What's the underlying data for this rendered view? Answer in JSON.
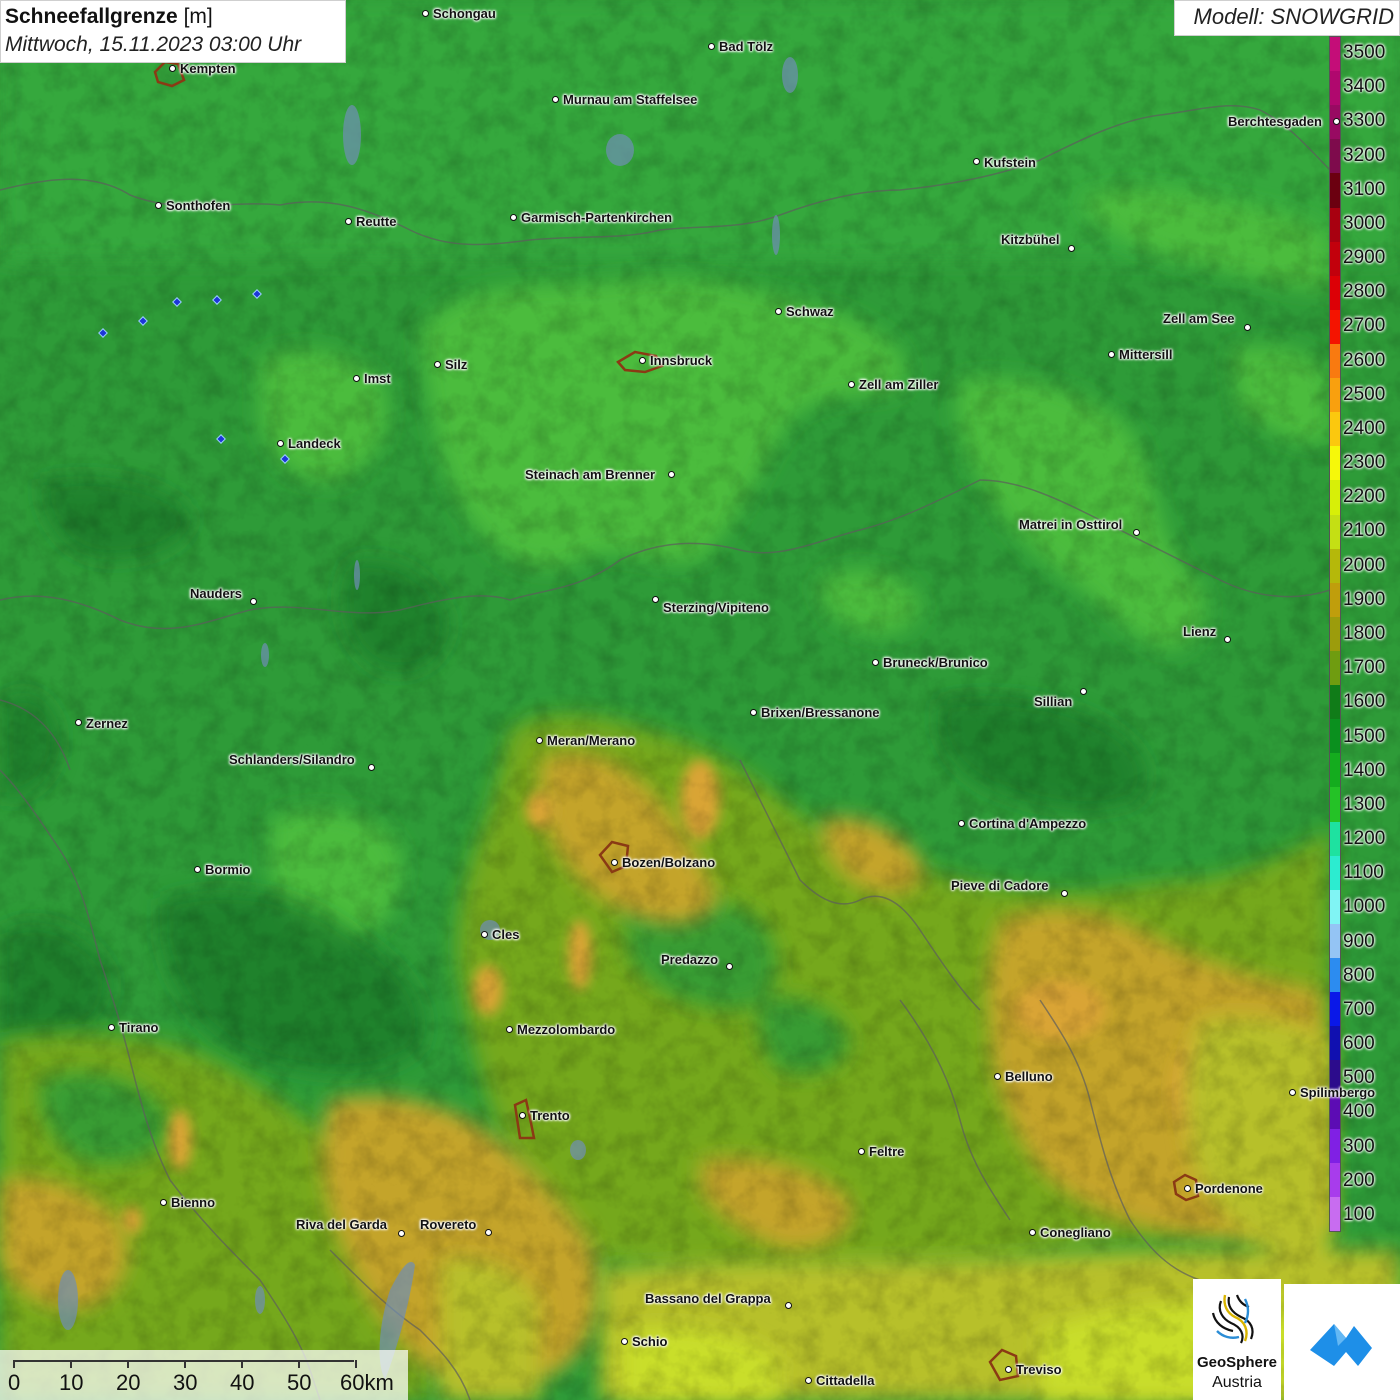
{
  "title": {
    "name": "Schneefallgrenze",
    "unit": "[m]",
    "datetime": "Mittwoch, 15.11.2023 03:00 Uhr"
  },
  "model": "Modell: SNOWGRID",
  "legend": {
    "labels": [
      "3500",
      "3400",
      "3300",
      "3200",
      "3100",
      "3000",
      "2900",
      "2800",
      "2700",
      "2600",
      "2500",
      "2400",
      "2300",
      "2200",
      "2100",
      "2000",
      "1900",
      "1800",
      "1700",
      "1600",
      "1500",
      "1400",
      "1300",
      "1200",
      "1100",
      "1000",
      "900",
      "800",
      "700",
      "600",
      "500",
      "400",
      "300",
      "200",
      "100"
    ],
    "colors": [
      "#c40d78",
      "#b0086e",
      "#980a62",
      "#7e0b4c",
      "#6b0010",
      "#a80010",
      "#c2000c",
      "#dc0006",
      "#f41400",
      "#f97a10",
      "#f9a00e",
      "#fbc80e",
      "#f6f80a",
      "#d7ef08",
      "#c4df14",
      "#b5b80a",
      "#c09e0c",
      "#9c9c0c",
      "#6f9c10",
      "#107c18",
      "#0a901e",
      "#14ac1e",
      "#24c226",
      "#1ee2a0",
      "#2cecd0",
      "#80f4f4",
      "#94c4f4",
      "#2c8cf0",
      "#0a18e8",
      "#1010b0",
      "#2c0c8c",
      "#5c0cb4",
      "#8020e4",
      "#a83cec",
      "#c86cf0"
    ]
  },
  "cities": [
    {
      "name": "Schongau",
      "dot": [
        425,
        13
      ],
      "label": [
        433,
        7
      ]
    },
    {
      "name": "Bad Tölz",
      "dot": [
        711,
        46
      ],
      "label": [
        719,
        40
      ]
    },
    {
      "name": "Kempten",
      "dot": [
        172,
        68
      ],
      "label": [
        180,
        62
      ]
    },
    {
      "name": "Murnau am Staffelsee",
      "dot": [
        555,
        99
      ],
      "label": [
        563,
        93
      ]
    },
    {
      "name": "Berchtesgaden",
      "dot": [
        1336,
        121
      ],
      "label": [
        1228,
        115
      ]
    },
    {
      "name": "Kufstein",
      "dot": [
        976,
        161
      ],
      "label": [
        984,
        156
      ]
    },
    {
      "name": "Sonthofen",
      "dot": [
        158,
        205
      ],
      "label": [
        166,
        199
      ]
    },
    {
      "name": "Reutte",
      "dot": [
        348,
        221
      ],
      "label": [
        356,
        215
      ]
    },
    {
      "name": "Garmisch-Partenkirchen",
      "dot": [
        513,
        217
      ],
      "label": [
        521,
        211
      ]
    },
    {
      "name": "Kitzbühel",
      "dot": [
        1071,
        248
      ],
      "label": [
        1001,
        233
      ]
    },
    {
      "name": "Schwaz",
      "dot": [
        778,
        311
      ],
      "label": [
        786,
        305
      ]
    },
    {
      "name": "Zell am See",
      "dot": [
        1247,
        327
      ],
      "label": [
        1163,
        312
      ]
    },
    {
      "name": "Mittersill",
      "dot": [
        1111,
        354
      ],
      "label": [
        1119,
        348
      ]
    },
    {
      "name": "Innsbruck",
      "dot": [
        642,
        360
      ],
      "label": [
        650,
        354
      ]
    },
    {
      "name": "Silz",
      "dot": [
        437,
        364
      ],
      "label": [
        445,
        358
      ]
    },
    {
      "name": "Imst",
      "dot": [
        356,
        378
      ],
      "label": [
        364,
        372
      ]
    },
    {
      "name": "Zell am Ziller",
      "dot": [
        851,
        384
      ],
      "label": [
        859,
        378
      ]
    },
    {
      "name": "Landeck",
      "dot": [
        280,
        443
      ],
      "label": [
        288,
        437
      ]
    },
    {
      "name": "Steinach am Brenner",
      "dot": [
        671,
        474
      ],
      "label": [
        525,
        468
      ]
    },
    {
      "name": "Matrei in Osttirol",
      "dot": [
        1136,
        532
      ],
      "label": [
        1019,
        518
      ]
    },
    {
      "name": "Nauders",
      "dot": [
        253,
        601
      ],
      "label": [
        190,
        587
      ]
    },
    {
      "name": "Sterzing/Vipiteno",
      "dot": [
        655,
        599
      ],
      "label": [
        663,
        601
      ]
    },
    {
      "name": "Lienz",
      "dot": [
        1227,
        639
      ],
      "label": [
        1183,
        625
      ]
    },
    {
      "name": "Bruneck/Brunico",
      "dot": [
        875,
        662
      ],
      "label": [
        883,
        656
      ]
    },
    {
      "name": "Sillian",
      "dot": [
        1083,
        691
      ],
      "label": [
        1034,
        695
      ]
    },
    {
      "name": "Brixen/Bressanone",
      "dot": [
        753,
        712
      ],
      "label": [
        761,
        706
      ]
    },
    {
      "name": "Zernez",
      "dot": [
        78,
        722
      ],
      "label": [
        86,
        717
      ]
    },
    {
      "name": "Meran/Merano",
      "dot": [
        539,
        740
      ],
      "label": [
        547,
        734
      ]
    },
    {
      "name": "Schlanders/Silandro",
      "dot": [
        371,
        767
      ],
      "label": [
        229,
        753
      ]
    },
    {
      "name": "Cortina d'Ampezzo",
      "dot": [
        961,
        823
      ],
      "label": [
        969,
        817
      ]
    },
    {
      "name": "Bozen/Bolzano",
      "dot": [
        614,
        862
      ],
      "label": [
        622,
        856
      ]
    },
    {
      "name": "Bormio",
      "dot": [
        197,
        869
      ],
      "label": [
        205,
        863
      ]
    },
    {
      "name": "Pieve di Cadore",
      "dot": [
        1064,
        893
      ],
      "label": [
        951,
        879
      ]
    },
    {
      "name": "Cles",
      "dot": [
        484,
        934
      ],
      "label": [
        492,
        928
      ]
    },
    {
      "name": "Predazzo",
      "dot": [
        729,
        966
      ],
      "label": [
        661,
        953
      ]
    },
    {
      "name": "Tirano",
      "dot": [
        111,
        1027
      ],
      "label": [
        119,
        1021
      ]
    },
    {
      "name": "Mezzolombardo",
      "dot": [
        509,
        1029
      ],
      "label": [
        517,
        1023
      ]
    },
    {
      "name": "Belluno",
      "dot": [
        997,
        1076
      ],
      "label": [
        1005,
        1070
      ]
    },
    {
      "name": "Spilimbergo",
      "dot": [
        1292,
        1092
      ],
      "label": [
        1300,
        1086
      ]
    },
    {
      "name": "Trento",
      "dot": [
        522,
        1115
      ],
      "label": [
        530,
        1109
      ]
    },
    {
      "name": "Feltre",
      "dot": [
        861,
        1151
      ],
      "label": [
        869,
        1145
      ]
    },
    {
      "name": "Pordenone",
      "dot": [
        1187,
        1188
      ],
      "label": [
        1195,
        1182
      ]
    },
    {
      "name": "Bienno",
      "dot": [
        163,
        1202
      ],
      "label": [
        171,
        1196
      ]
    },
    {
      "name": "Riva del Garda",
      "dot": [
        401,
        1233
      ],
      "label": [
        296,
        1218
      ]
    },
    {
      "name": "Rovereto",
      "dot": [
        488,
        1232
      ],
      "label": [
        420,
        1218
      ]
    },
    {
      "name": "Conegliano",
      "dot": [
        1032,
        1232
      ],
      "label": [
        1040,
        1226
      ]
    },
    {
      "name": "Bassano del Grappa",
      "dot": [
        788,
        1305
      ],
      "label": [
        645,
        1292
      ]
    },
    {
      "name": "Schio",
      "dot": [
        624,
        1341
      ],
      "label": [
        632,
        1335
      ]
    },
    {
      "name": "Treviso",
      "dot": [
        1008,
        1369
      ],
      "label": [
        1016,
        1363
      ]
    },
    {
      "name": "Cittadella",
      "dot": [
        808,
        1380
      ],
      "label": [
        816,
        1374
      ]
    }
  ],
  "scale": {
    "labels": [
      "0",
      "10",
      "20",
      "30",
      "40",
      "50",
      "60km"
    ]
  },
  "logo": {
    "line1": "GeoSphere",
    "line2": "Austria"
  }
}
